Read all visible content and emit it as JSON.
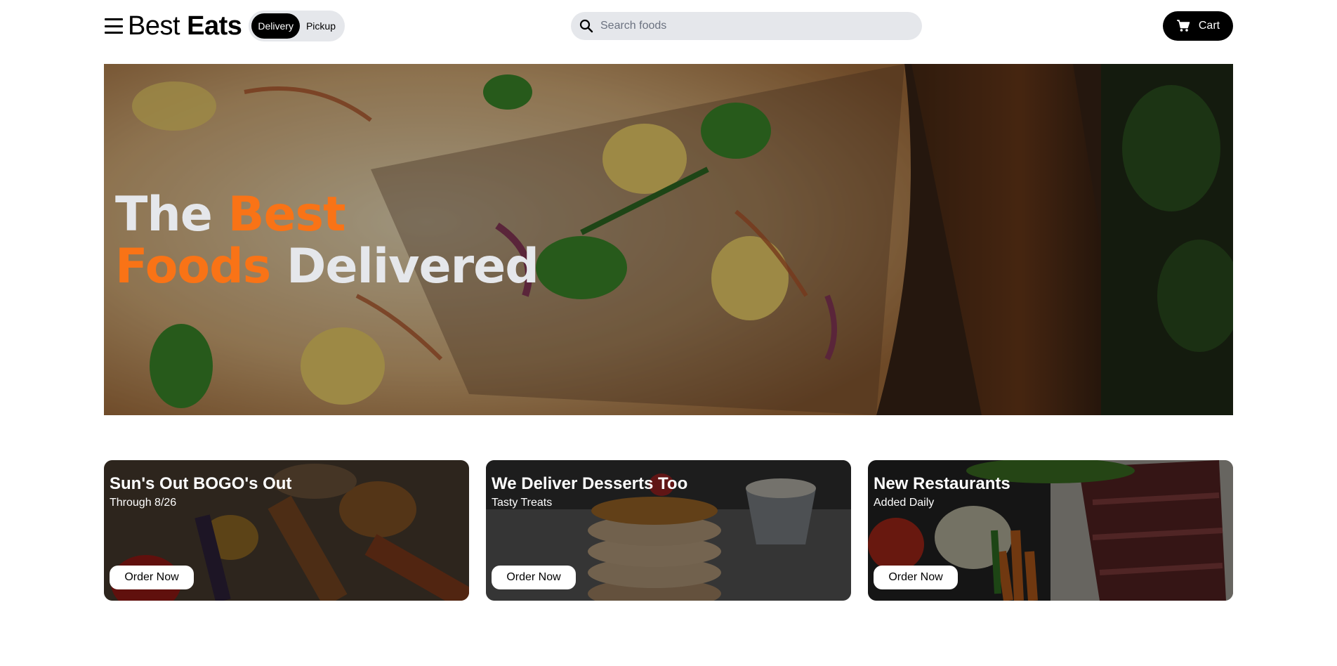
{
  "header": {
    "logo_light": "Best",
    "logo_bold": "Eats",
    "toggle": {
      "delivery_label": "Delivery",
      "pickup_label": "Pickup",
      "selected": "Delivery"
    },
    "search": {
      "placeholder": "Search foods",
      "value": ""
    },
    "cart_label": "Cart",
    "icons": {
      "menu": "hamburger-menu-icon",
      "search": "search-icon",
      "cart": "cart-icon"
    }
  },
  "hero": {
    "title_part1": "The",
    "title_part2": "Best",
    "title_part3": "Foods",
    "title_part4": "Delivered",
    "image": "pizza-photo",
    "accent_color": "#f97316",
    "text_color": "#e5e7eb"
  },
  "cards": [
    {
      "title": "Sun's Out BOGO's Out",
      "subtitle": "Through 8/26",
      "button": "Order Now",
      "image": "grilled-meats-photo"
    },
    {
      "title": "We Deliver Desserts Too",
      "subtitle": "Tasty Treats",
      "button": "Order Now",
      "image": "pancakes-photo"
    },
    {
      "title": "New Restaurants",
      "subtitle": "Added Daily",
      "button": "Order Now",
      "image": "steak-vegetables-photo"
    }
  ]
}
